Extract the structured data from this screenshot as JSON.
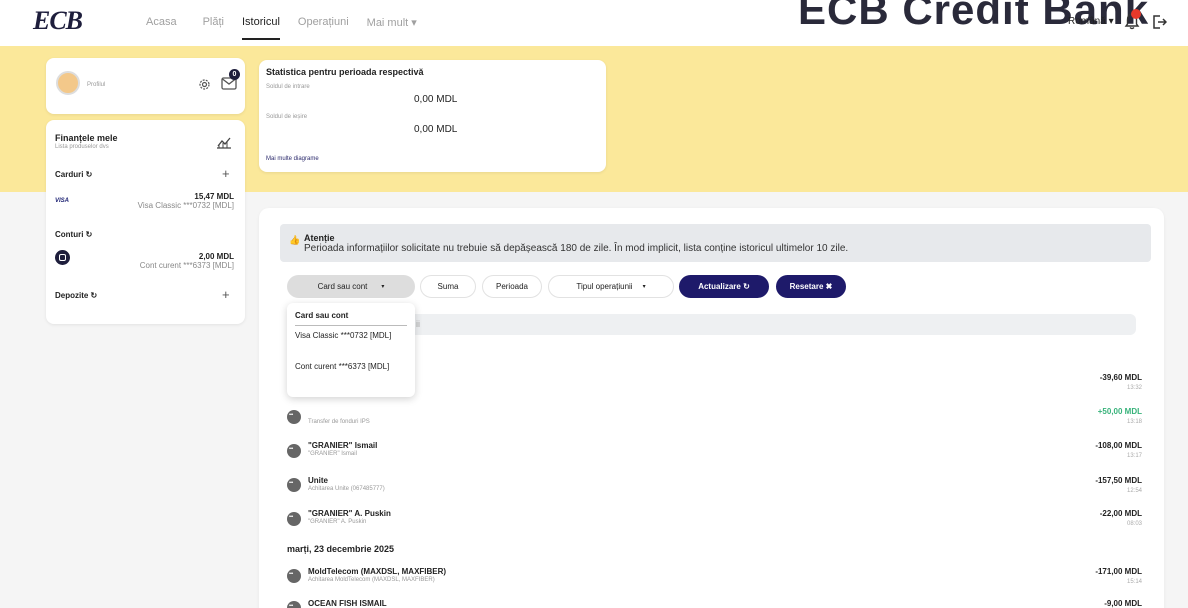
{
  "nav": {
    "logo": "ECB",
    "links": [
      "Acasa",
      "Plăți",
      "Istoricul",
      "Operațiuni",
      "Mai mult ▾"
    ],
    "active_index": 2,
    "brand_text": "ECB Credit Bank",
    "language": "Română ▾"
  },
  "profile": {
    "label": "Profilul",
    "messages_count": "0"
  },
  "finances": {
    "title": "Finanțele mele",
    "subtitle": "Lista produselor dvs",
    "cards_label": "Carduri ↻",
    "card_amount": "15,47 MDL",
    "card_name": "Visa Classic ***0732 [MDL]",
    "card_brand": "VISA",
    "accounts_label": "Conturi ↻",
    "account_amount": "2,00 MDL",
    "account_name": "Cont curent ***6373 [MDL]",
    "deposits_label": "Depozite ↻",
    "plus": "+"
  },
  "stats": {
    "title": "Statistica pentru perioada respectivă",
    "opening_label": "Soldul de intrare",
    "opening_value": "0,00 MDL",
    "closing_label": "Soldul de ieșire",
    "closing_value": "0,00 MDL",
    "more_link": "Mai multe diagrame"
  },
  "notice": {
    "icon": "👍",
    "title": "Atenție",
    "text": "Perioada informațiilor solicitate nu trebuie să depășească 180 de zile. În mod implicit, lista conține istoricul ultimelor 10 zile."
  },
  "filters": {
    "card_or_account": "Card sau cont",
    "caret": "▾",
    "amount": "Suma",
    "period": "Perioada",
    "operation_type": "Tipul operațiunii",
    "update": "Actualizare ↻",
    "reset": "Resetare ✖"
  },
  "dropdown": {
    "options": [
      "Card sau cont",
      "Visa Classic ***0732 [MDL]",
      "Cont curent ***6373 [MDL]"
    ]
  },
  "search": {
    "visible_fragment": "ii"
  },
  "transactions": [
    {
      "name": "",
      "desc": "",
      "amount": "-39,60 MDL",
      "time": "13:32",
      "positive": false,
      "show_icon": false
    },
    {
      "name": "",
      "desc": "Transfer de fonduri IPS",
      "amount": "+50,00 MDL",
      "time": "13:18",
      "positive": true,
      "show_icon": true
    },
    {
      "name": "\"GRANIER\" Ismail",
      "desc": "\"GRANIER\" Ismail",
      "amount": "-108,00 MDL",
      "time": "13:17",
      "positive": false,
      "show_icon": true
    },
    {
      "name": "Unite",
      "desc": "Achitarea Unite (067485777)",
      "amount": "-157,50 MDL",
      "time": "12:54",
      "positive": false,
      "show_icon": true
    },
    {
      "name": "\"GRANIER\" A. Puskin",
      "desc": "\"GRANIER\" A. Puskin",
      "amount": "-22,00 MDL",
      "time": "08:03",
      "positive": false,
      "show_icon": true
    }
  ],
  "date_header": "marți, 23 decembrie 2025",
  "transactions2": [
    {
      "name": "MoldTelecom (MAXDSL, MAXFIBER)",
      "desc": "Achitarea MoldTelecom (MAXDSL, MAXFIBER)",
      "amount": "-171,00 MDL",
      "time": "15:14"
    },
    {
      "name": "OCEAN FISH ISMAIL",
      "desc": "",
      "amount": "-9,00 MDL",
      "time": ""
    }
  ],
  "colors": {
    "accent": "#1e1a6a",
    "band": "#fbe89a",
    "positive": "#37b27a",
    "badge": "#e8392b"
  }
}
